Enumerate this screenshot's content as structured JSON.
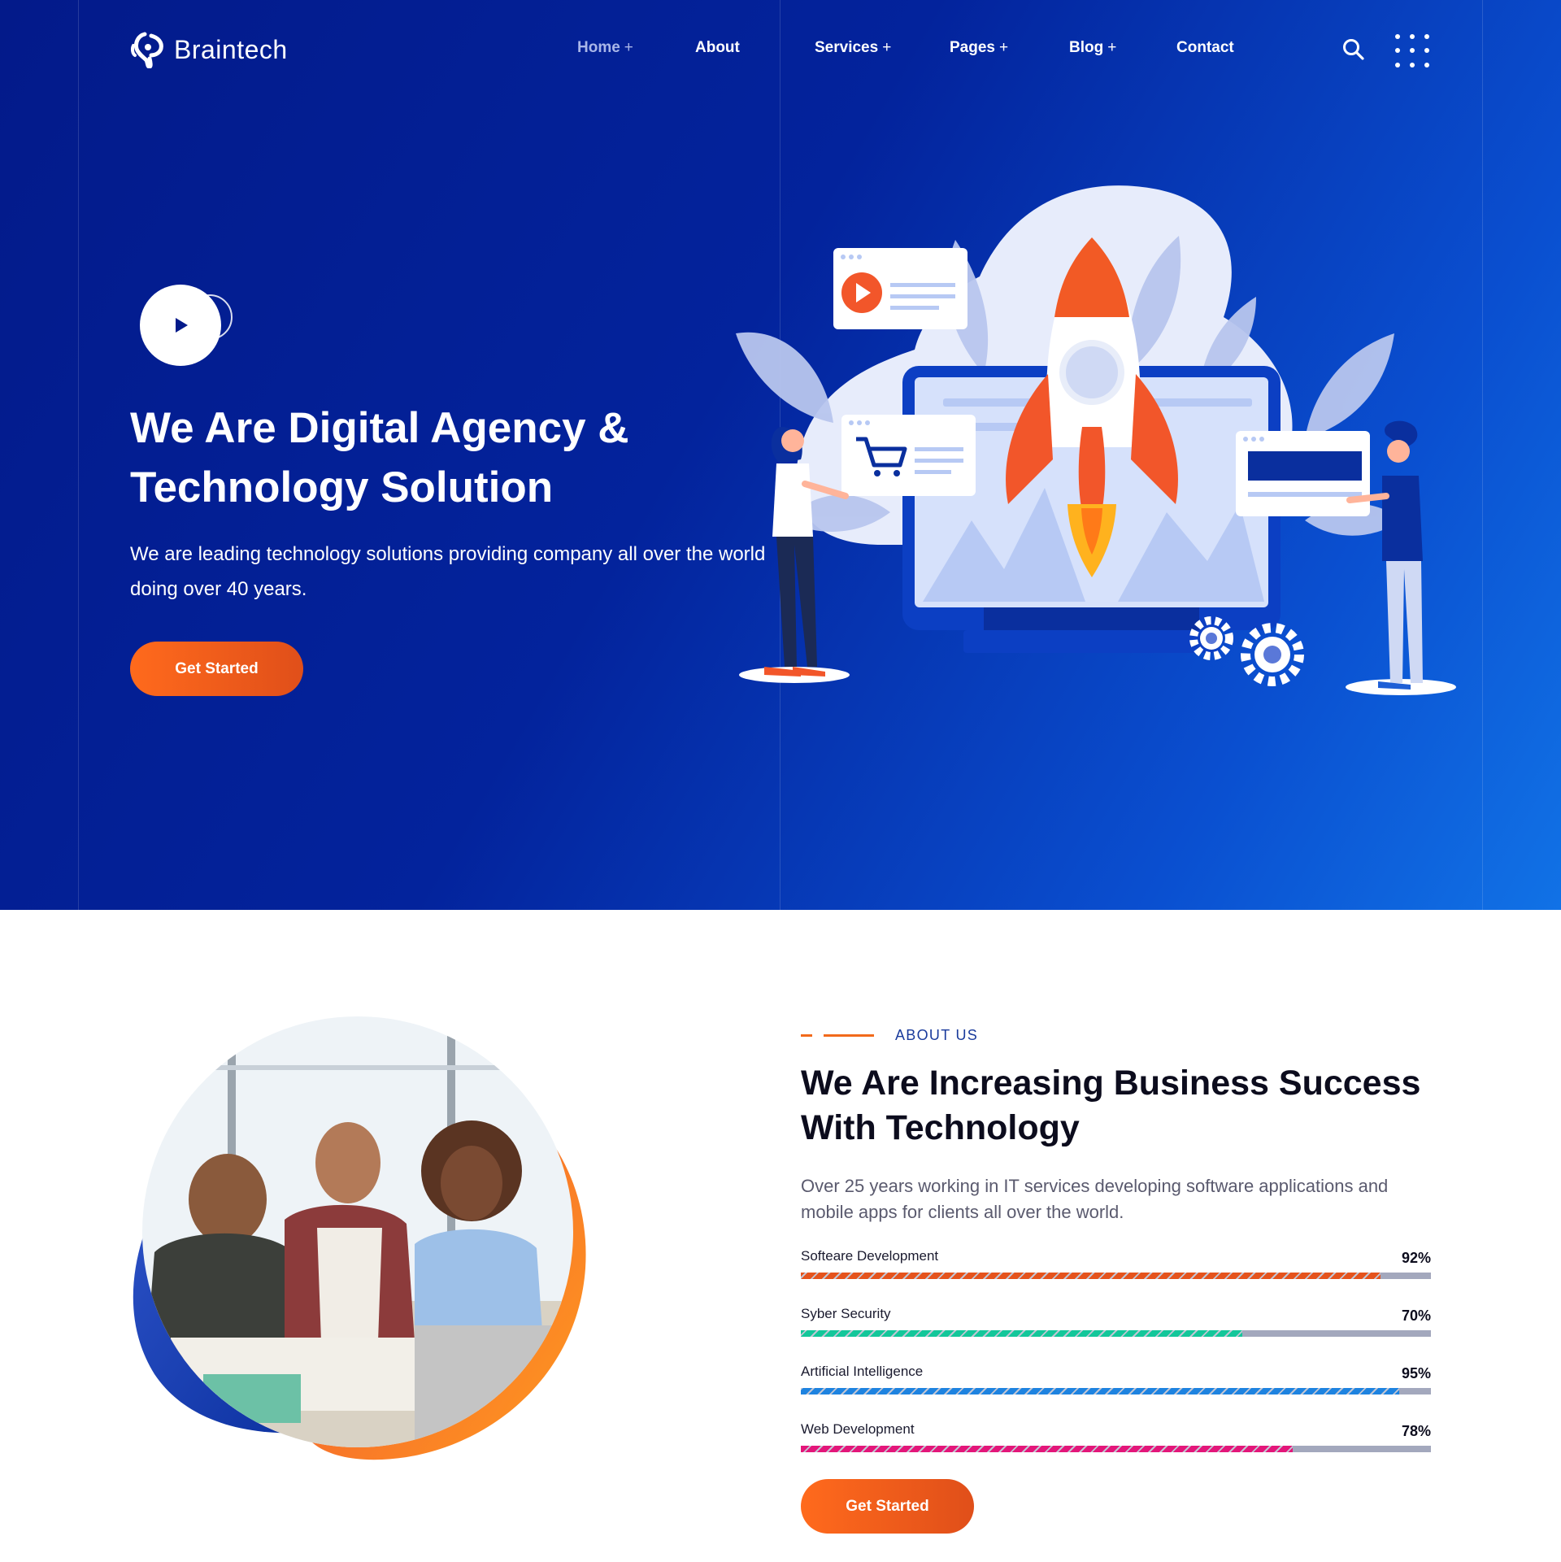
{
  "header": {
    "logo_text": "Braintech",
    "nav": [
      {
        "label": "Home",
        "has_submenu": true,
        "active": true
      },
      {
        "label": "About",
        "has_submenu": false
      },
      {
        "label": "Services",
        "has_submenu": true
      },
      {
        "label": "Pages",
        "has_submenu": true
      },
      {
        "label": "Blog",
        "has_submenu": true
      },
      {
        "label": "Contact",
        "has_submenu": false
      }
    ],
    "submenu_marker": "+",
    "icons": {
      "search": "search-icon",
      "menu": "dots-grid-icon"
    }
  },
  "hero": {
    "title": "We Are Digital Agency & Technology Solution",
    "description": "We are leading technology solutions providing company all over the world doing over 40 years.",
    "cta_label": "Get Started",
    "play_icon": "play-icon"
  },
  "about": {
    "tag": "ABOUT US",
    "title": "We Are Increasing Business Success With Technology",
    "description": "Over 25 years working in IT services developing software applications and mobile apps for clients all over the world.",
    "skills": [
      {
        "name": "Softeare Development",
        "percent_label": "92%",
        "value": 92,
        "color": "#e5531c"
      },
      {
        "name": "Syber Security",
        "percent_label": "70%",
        "value": 70,
        "color": "#13c79a"
      },
      {
        "name": "Artificial Intelligence",
        "percent_label": "95%",
        "value": 95,
        "color": "#1e83e0"
      },
      {
        "name": "Web Development",
        "percent_label": "78%",
        "value": 78,
        "color": "#e3167a"
      }
    ],
    "cta_label": "Get Started"
  },
  "colors": {
    "hero_bg_start": "#031a8a",
    "hero_bg_end": "#1172e6",
    "accent": "#f26a1b",
    "tag_text": "#1a3b9c"
  }
}
